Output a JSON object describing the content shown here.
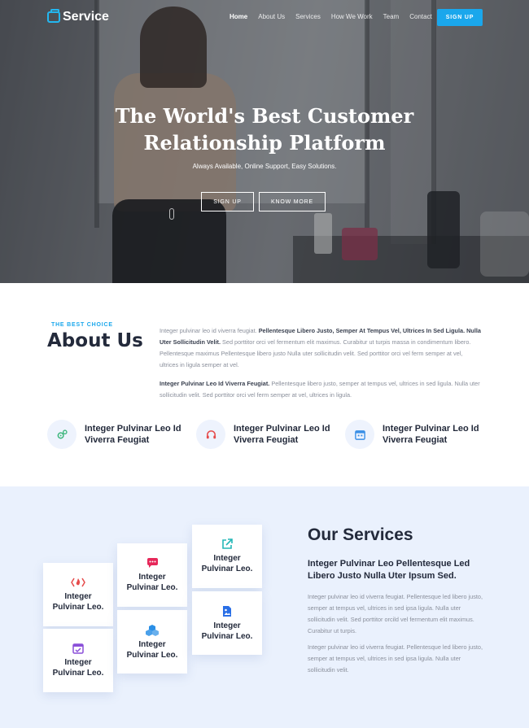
{
  "nav": {
    "logo": "Service",
    "items": [
      {
        "label": "Home",
        "active": true
      },
      {
        "label": "About Us"
      },
      {
        "label": "Services"
      },
      {
        "label": "How We Work"
      },
      {
        "label": "Team"
      },
      {
        "label": "Contact"
      }
    ],
    "cta": "SIGN UP"
  },
  "hero": {
    "title_line1": "The World's Best Customer",
    "title_line2": "Relationship Platform",
    "subtitle": "Always Available, Online Support, Easy Solutions.",
    "btn_primary": "SIGN UP",
    "btn_secondary": "KNOW MORE"
  },
  "about": {
    "tag": "THE BEST CHOICE",
    "title": "About Us",
    "p1_normal1": "Integer pulvinar leo id viverra feugiat. ",
    "p1_bold": "Pellentesque Libero Justo, Semper At Tempus Vel, Ultrices In Sed Ligula. Nulla Uter Sollicitudin Velit.",
    "p1_normal2": " Sed porttitor orci vel fermentum elit maximus. Curabitur ut turpis massa in condimentum libero. Pellentesque maximus Pellentesque libero justo Nulla uter sollicitudin velit. Sed porttitor orci vel ferm semper at vel, ultrices in ligula semper at vel.",
    "p2_bold": "Integer Pulvinar Leo Id Viverra Feugiat.",
    "p2_normal": " Pellentesque libero justo, semper at tempus vel, ultrices in sed ligula. Nulla uter sollicitudin velit. Sed porttitor orci vel ferm semper at vel, ultrices in ligula.",
    "features": [
      {
        "line1": "Integer Pulvinar Leo Id",
        "line2": "Viverra Feugiat",
        "icon": "gears-icon",
        "color": "#3bb67b"
      },
      {
        "line1": "Integer Pulvinar Leo Id",
        "line2": "Viverra Feugiat",
        "icon": "headphones-icon",
        "color": "#e64b4b"
      },
      {
        "line1": "Integer Pulvinar Leo Id",
        "line2": "Viverra Feugiat",
        "icon": "calendar-icon",
        "color": "#3a8fe6"
      }
    ]
  },
  "services": {
    "title": "Our Services",
    "subtitle": "Integer Pulvinar Leo Pellentesque Led Libero Justo Nulla Uter Ipsum Sed.",
    "p1": "Integer pulvinar leo id viverra feugiat. Pellentesque led libero justo, semper at tempus vel, ultrices in sed ipsa ligula. Nulla uter sollicitudin velit. Sed porttitor orcild vel fermentum elit maximus. Curabitur ut turpis.",
    "p2": "Integer pulvinar leo id viverra feugiat. Pellentesque led libero justo, semper at tempus vel, ultrices in sed ipsa ligula. Nulla uter sollicitudin velit.",
    "cards": [
      {
        "line1": "Integer",
        "line2": "Pulvinar Leo.",
        "icon": "fire-icon",
        "color": "#e64b4b"
      },
      {
        "line1": "Integer",
        "line2": "Pulvinar Leo.",
        "icon": "calendar-check-icon",
        "color": "#8a4fd8"
      },
      {
        "line1": "Integer",
        "line2": "Pulvinar Leo.",
        "icon": "chat-icon",
        "color": "#e6285a"
      },
      {
        "line1": "Integer",
        "line2": "Pulvinar Leo.",
        "icon": "cubes-icon",
        "color": "#2a8fe6"
      },
      {
        "line1": "Integer",
        "line2": "Pulvinar Leo.",
        "icon": "external-link-icon",
        "color": "#23b7b7"
      },
      {
        "line1": "Integer",
        "line2": "Pulvinar Leo.",
        "icon": "image-file-icon",
        "color": "#2a6fe6"
      }
    ]
  }
}
